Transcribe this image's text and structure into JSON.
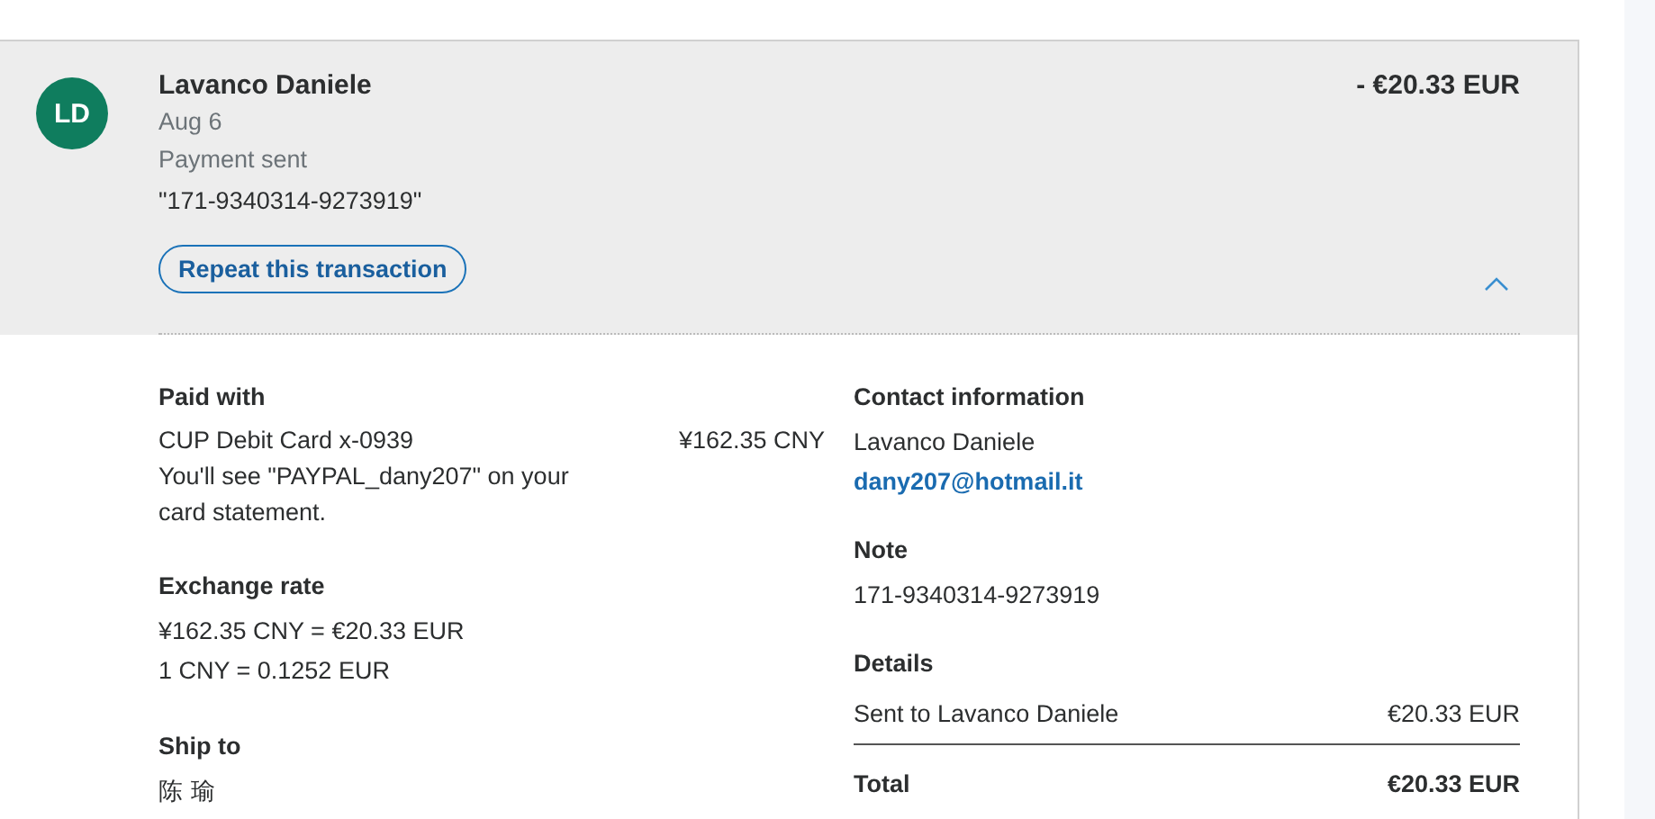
{
  "transaction": {
    "initials": "LD",
    "name": "Lavanco Daniele",
    "date": "Aug 6",
    "status": "Payment sent",
    "reference": "\"171-9340314-9273919\"",
    "amount": "- €20.33 EUR",
    "repeat_button": "Repeat this transaction",
    "expanded": true
  },
  "paid_with": {
    "heading": "Paid with",
    "method": "CUP Debit Card x-0939",
    "amount": "¥162.35 CNY",
    "statement_note": "You'll see \"PAYPAL_dany207\" on your card statement."
  },
  "exchange_rate": {
    "heading": "Exchange rate",
    "lines": [
      "¥162.35 CNY = €20.33 EUR",
      "1 CNY = 0.1252 EUR"
    ]
  },
  "ship_to": {
    "heading": "Ship to",
    "name": "陈 瑜"
  },
  "contact": {
    "heading": "Contact information",
    "name": "Lavanco Daniele",
    "email": "dany207@hotmail.it"
  },
  "note": {
    "heading": "Note",
    "text": "171-9340314-9273919"
  },
  "details": {
    "heading": "Details",
    "rows": [
      {
        "label": "Sent to Lavanco Daniele",
        "value": "€20.33 EUR"
      }
    ],
    "total_label": "Total",
    "total_value": "€20.33 EUR"
  }
}
